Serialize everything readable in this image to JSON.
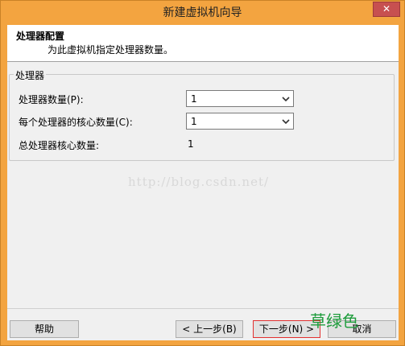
{
  "window": {
    "title": "新建虚拟机向导",
    "close_label": "✕"
  },
  "header": {
    "title": "处理器配置",
    "subtitle": "为此虚拟机指定处理器数量。"
  },
  "group": {
    "legend": "处理器",
    "processor_count": {
      "label": "处理器数量(P):",
      "value": "1"
    },
    "cores_per_processor": {
      "label": "每个处理器的核心数量(C):",
      "value": "1"
    },
    "total_cores": {
      "label": "总处理器核心数量:",
      "value": "1"
    }
  },
  "watermark": "http://blog.csdn.net/",
  "buttons": {
    "help": "帮助",
    "back": "< 上一步(B)",
    "next": "下一步(N) >",
    "cancel": "取消"
  },
  "stamp": "草绿色",
  "colors": {
    "titlebar": "#f3a440",
    "close": "#c75050",
    "stamp": "#1e9c3c"
  }
}
